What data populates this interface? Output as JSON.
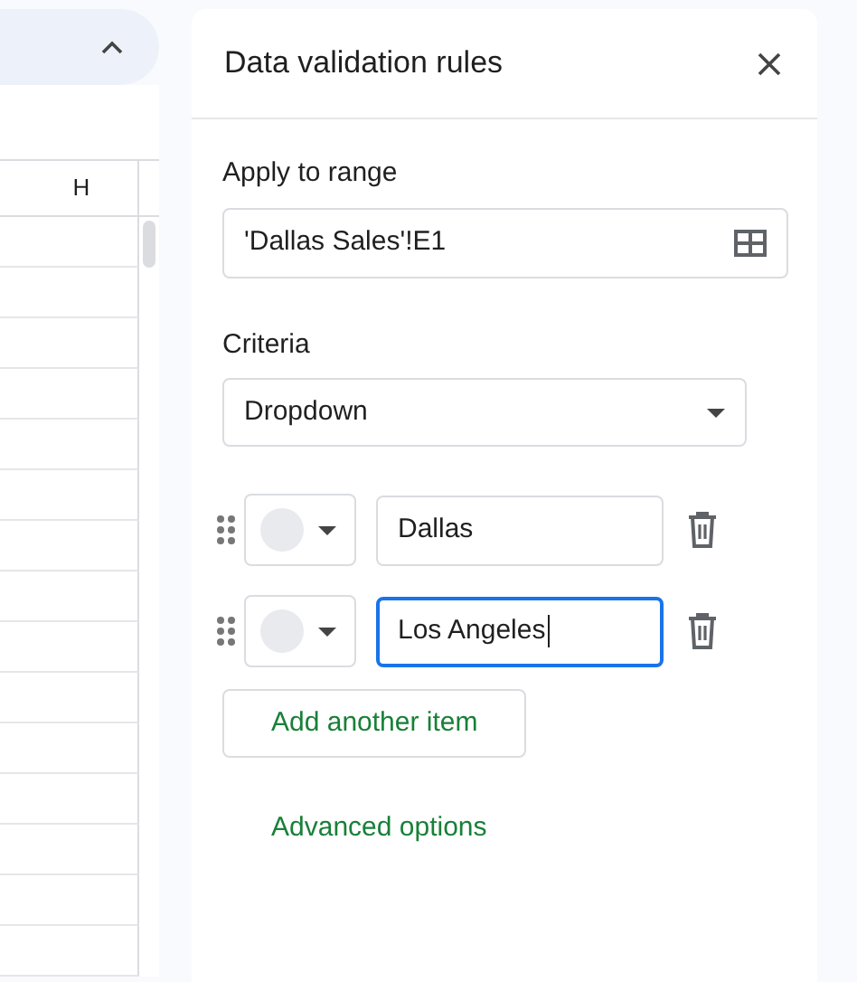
{
  "sheet": {
    "column_header": "H"
  },
  "panel": {
    "title": "Data validation rules",
    "range_label": "Apply to range",
    "range_value": "'Dallas Sales'!E1",
    "criteria_label": "Criteria",
    "criteria_value": "Dropdown",
    "items": [
      {
        "value": "Dallas",
        "focused": false
      },
      {
        "value": "Los Angeles",
        "focused": true
      }
    ],
    "add_button": "Add another item",
    "advanced_link": "Advanced options"
  }
}
